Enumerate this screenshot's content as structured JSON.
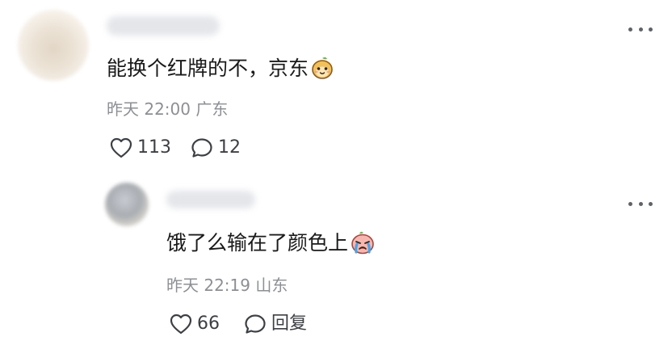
{
  "comment": {
    "text": "能换个红牌的不，京东",
    "emoji_icon": "pear-face-icon",
    "meta": "昨天 22:00 广东",
    "likes": "113",
    "replies": "12"
  },
  "reply": {
    "text": "饿了么输在了颜色上",
    "emoji_icon": "crying-face-icon",
    "meta": "昨天 22:19 山东",
    "likes": "66",
    "reply_label": "回复"
  }
}
